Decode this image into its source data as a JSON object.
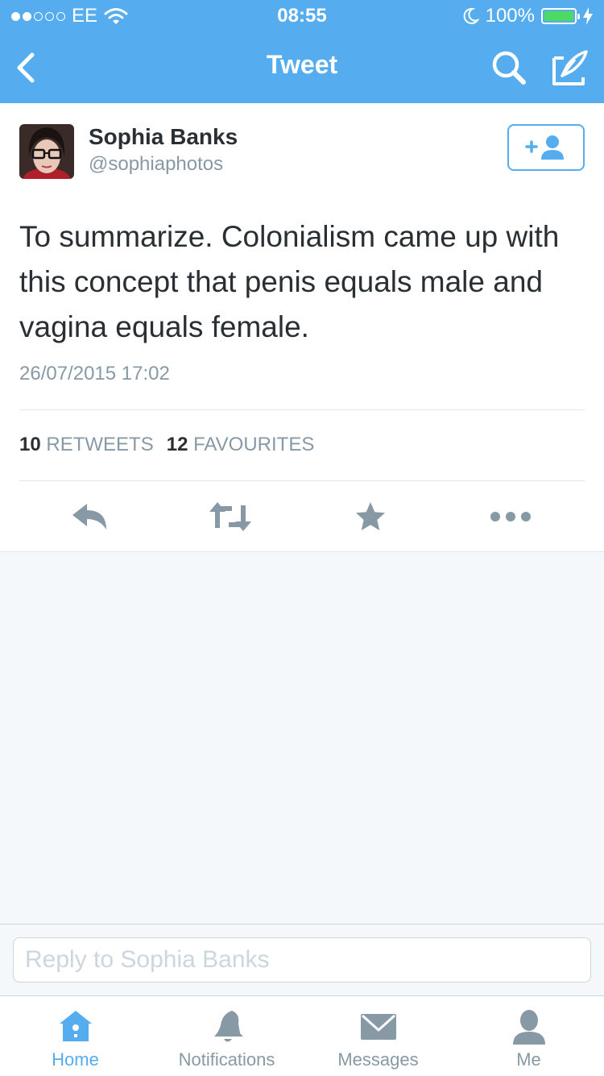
{
  "status_bar": {
    "carrier": "EE",
    "time": "08:55",
    "battery": "100%",
    "signal_dots_filled": 2,
    "signal_dots_total": 5
  },
  "nav": {
    "title": "Tweet"
  },
  "tweet": {
    "author_name": "Sophia Banks",
    "author_handle": "@sophiaphotos",
    "text": "To summarize. Colonialism came up with this concept that penis equals male and vagina equals female.",
    "timestamp": "26/07/2015 17:02",
    "retweet_count": "10",
    "retweet_label": "RETWEETS",
    "favourite_count": "12",
    "favourite_label": "FAVOURITES"
  },
  "reply": {
    "placeholder": "Reply to Sophia Banks"
  },
  "tabs": [
    {
      "label": "Home",
      "icon": "home-icon",
      "active": true
    },
    {
      "label": "Notifications",
      "icon": "bell-icon",
      "active": false
    },
    {
      "label": "Messages",
      "icon": "envelope-icon",
      "active": false
    },
    {
      "label": "Me",
      "icon": "person-icon",
      "active": false
    }
  ],
  "colors": {
    "brand": "#55acee",
    "text": "#292f33",
    "muted": "#8899a6",
    "battery": "#4cd964"
  }
}
